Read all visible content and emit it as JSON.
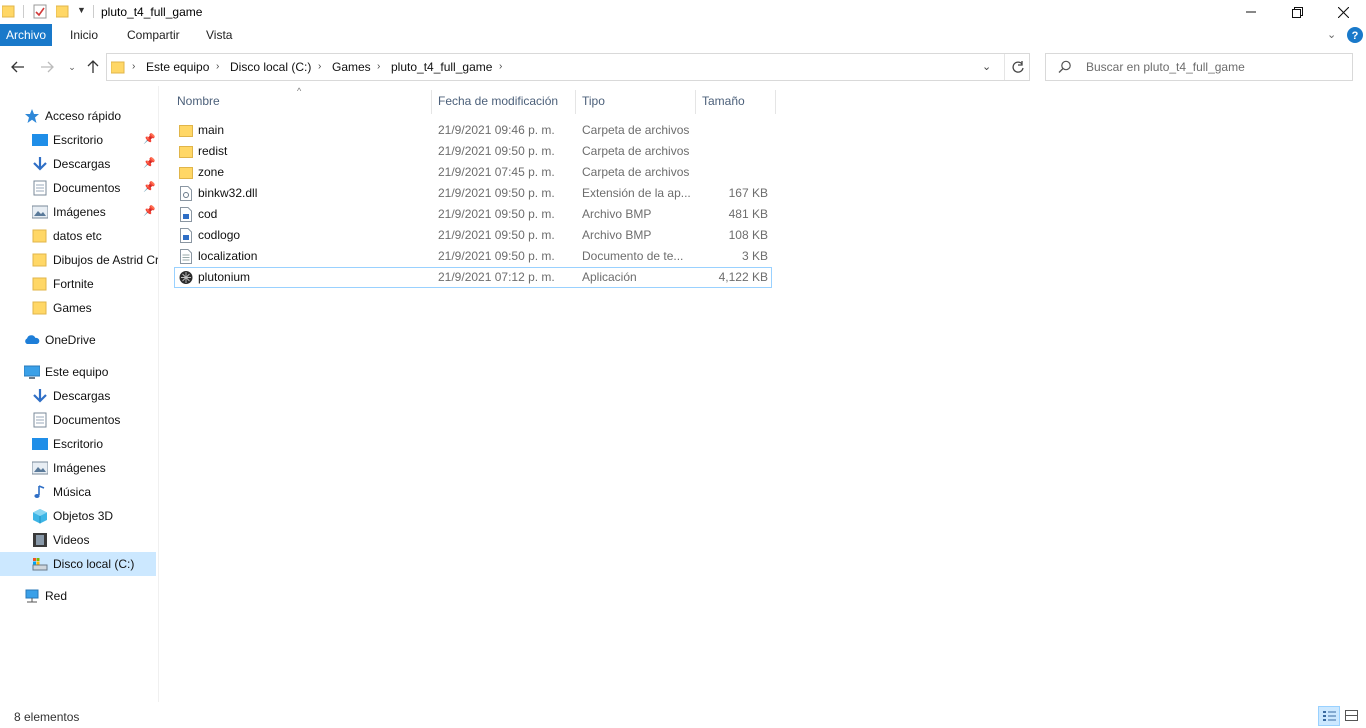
{
  "window": {
    "title": "pluto_t4_full_game"
  },
  "ribbon": {
    "tabs": [
      "Archivo",
      "Inicio",
      "Compartir",
      "Vista"
    ]
  },
  "address": {
    "crumbs": [
      "Este equipo",
      "Disco local (C:)",
      "Games",
      "pluto_t4_full_game"
    ]
  },
  "search": {
    "placeholder": "Buscar en pluto_t4_full_game"
  },
  "nav": {
    "quick_access": "Acceso rápido",
    "quick_items": [
      "Escritorio",
      "Descargas",
      "Documentos",
      "Imágenes",
      "datos etc",
      "Dibujos de Astrid Cr",
      "Fortnite",
      "Games"
    ],
    "onedrive": "OneDrive",
    "this_pc": "Este equipo",
    "pc_items": [
      "Descargas",
      "Documentos",
      "Escritorio",
      "Imágenes",
      "Música",
      "Objetos 3D",
      "Videos",
      "Disco local (C:)"
    ],
    "network": "Red",
    "selected": "Disco local (C:)"
  },
  "columns": {
    "name": "Nombre",
    "date": "Fecha de modificación",
    "type": "Tipo",
    "size": "Tamaño"
  },
  "files": [
    {
      "name": "main",
      "date": "21/9/2021 09:46 p. m.",
      "type": "Carpeta de archivos",
      "size": "",
      "icon": "folder-icon"
    },
    {
      "name": "redist",
      "date": "21/9/2021 09:50 p. m.",
      "type": "Carpeta de archivos",
      "size": "",
      "icon": "folder-icon"
    },
    {
      "name": "zone",
      "date": "21/9/2021 07:45 p. m.",
      "type": "Carpeta de archivos",
      "size": "",
      "icon": "folder-icon"
    },
    {
      "name": "binkw32.dll",
      "date": "21/9/2021 09:50 p. m.",
      "type": "Extensión de la ap...",
      "size": "167 KB",
      "icon": "dll-file-icon"
    },
    {
      "name": "cod",
      "date": "21/9/2021 09:50 p. m.",
      "type": "Archivo BMP",
      "size": "481 KB",
      "icon": "image-file-icon"
    },
    {
      "name": "codlogo",
      "date": "21/9/2021 09:50 p. m.",
      "type": "Archivo BMP",
      "size": "108 KB",
      "icon": "image-file-icon"
    },
    {
      "name": "localization",
      "date": "21/9/2021 09:50 p. m.",
      "type": "Documento de te...",
      "size": "3 KB",
      "icon": "text-file-icon"
    },
    {
      "name": "plutonium",
      "date": "21/9/2021 07:12 p. m.",
      "type": "Aplicación",
      "size": "4,122 KB",
      "icon": "plutonium-app-icon"
    }
  ],
  "status": {
    "count": "8 elementos"
  },
  "colors": {
    "accent": "#1979ca",
    "selection": "#cce8ff",
    "folder": "#ffd766"
  }
}
